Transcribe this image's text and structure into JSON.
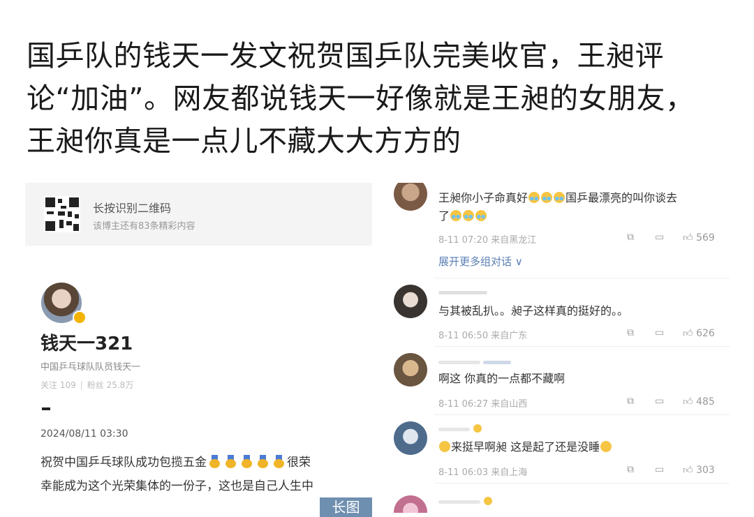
{
  "headline": {
    "line1": "国乒队的钱天一发文祝贺国乒队完美收官，王昶评",
    "line2": "论“加油”。网友都说钱天一好像就是王昶的女朋友，",
    "line3": "王昶你真是一点儿不藏大大方方的"
  },
  "left_panel": {
    "qr_title": "长按识别二维码",
    "qr_subtitle": "该博主还有83条精彩内容",
    "username": "钱天一321",
    "bio": "中国乒乓球队队员钱天一",
    "follow_label": "关注 109",
    "fans_label": "粉丝 25.8万",
    "post_date": "2024/08/11 03:30",
    "post_line1_a": "祝贺中国乒乓球队成功包揽五金",
    "post_line1_b": "很荣",
    "post_line2": "幸能成为这个光荣集体的一份子，这也是自己人生中",
    "long_image_button": "长图"
  },
  "comments": [
    {
      "text_a": "王昶你小子命真好",
      "text_b": "国乒最漂亮的叫你谈去",
      "text_c": "了",
      "meta": "8-11 07:20  来自黑龙江",
      "likes": "569",
      "expand": "展开更多组对话 ∨"
    },
    {
      "text": "与其被乱扒。。昶子这样真的挺好的。。",
      "meta": "8-11 06:50  来自广东",
      "likes": "626"
    },
    {
      "text": "啊这 你真的一点都不藏啊",
      "meta": "8-11 06:27  来自山西",
      "likes": "485"
    },
    {
      "text": "来挺早啊昶  这是起了还是没睡",
      "meta": "8-11 06:03  来自上海",
      "likes": "303"
    }
  ]
}
